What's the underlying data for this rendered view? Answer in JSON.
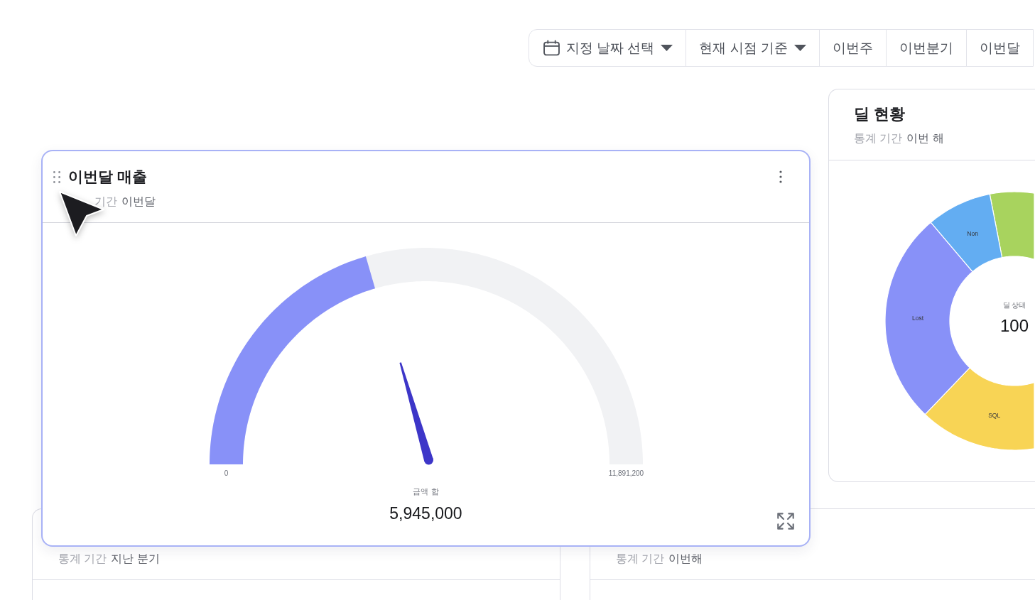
{
  "toolbar": [
    {
      "kind": "date-picker",
      "label": "지정 날짜 선택"
    },
    {
      "kind": "dropdown",
      "label": "현재 시점 기준"
    },
    {
      "kind": "preset",
      "label": "이번주"
    },
    {
      "kind": "preset",
      "label": "이번분기"
    },
    {
      "kind": "preset",
      "label": "이번달"
    }
  ],
  "deal_card": {
    "title": "딜 현황",
    "period_label": "통계 기간",
    "period_value": "이번 해",
    "donut": {
      "center_label": "딜 상태",
      "center_value": "100",
      "segments": [
        {
          "color": "#a8d35e"
        },
        {
          "label": "SQL",
          "color": "#f8d455"
        },
        {
          "label": "Lost",
          "color": "#8891f8"
        },
        {
          "label": "Non",
          "color": "#63adf2"
        }
      ]
    }
  },
  "dragged_card": {
    "title": "이번달 매출",
    "period_label": "기간",
    "period_value": "이번달",
    "gauge": {
      "level": 0.41,
      "min_label": "0",
      "max_label": "11,891,200",
      "value_label": "금액 합",
      "value": "5,945,000"
    }
  },
  "bottom_cards": [
    {
      "period_label": "통계 기간",
      "period_value": "지난 분기"
    },
    {
      "period_label": "통계 기간",
      "period_value": "이번해"
    }
  ]
}
